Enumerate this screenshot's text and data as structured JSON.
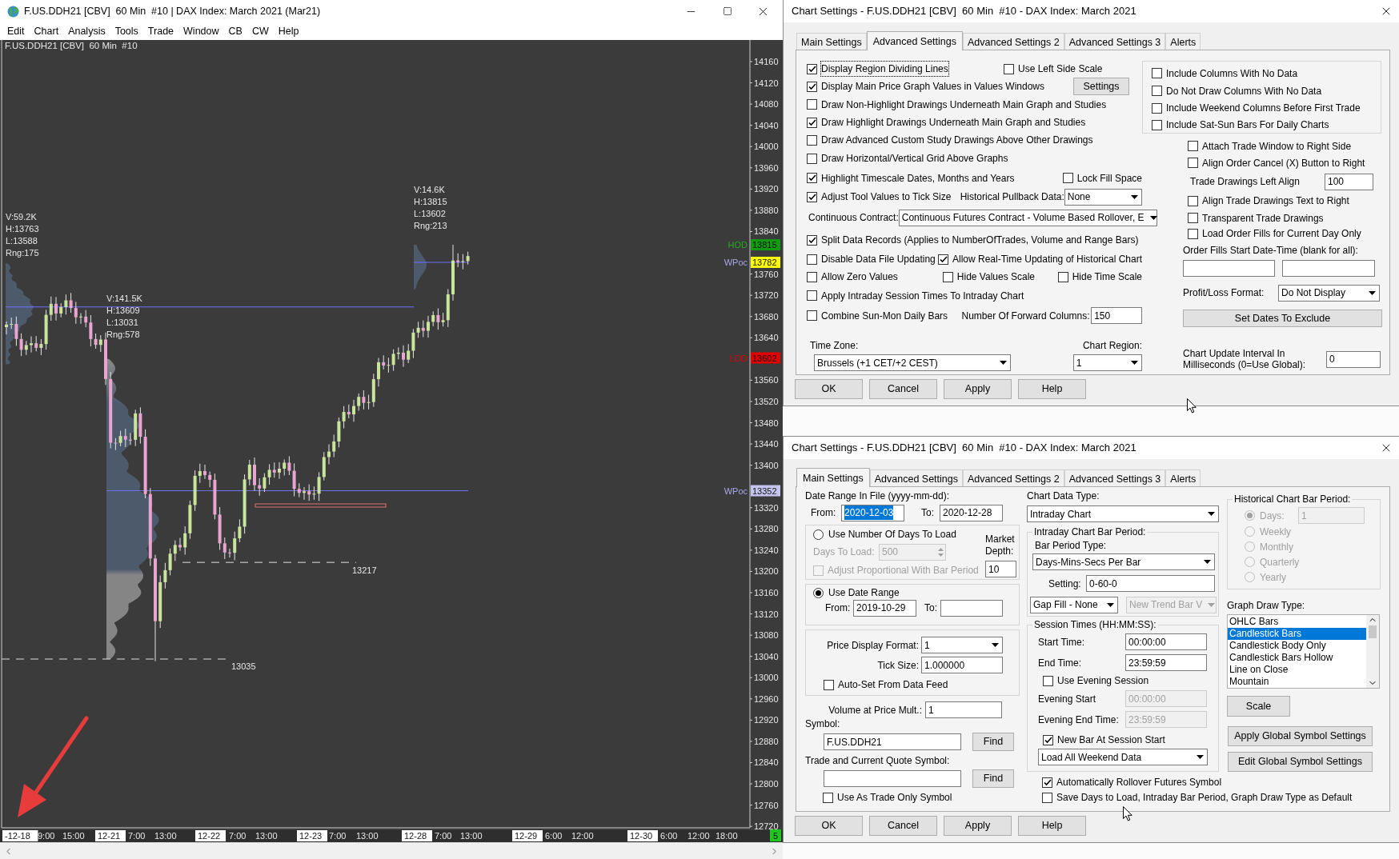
{
  "chart_window": {
    "title": "F.US.DDH21 [CBV]  60 Min  #10 | DAX Index: March 2021 (Mar21)",
    "menu": [
      "Edit",
      "Chart",
      "Analysis",
      "Tools",
      "Trade",
      "Window",
      "CB",
      "CW",
      "Help"
    ],
    "chart_label": "F.US.DDH21 [CBV]  60 Min  #10",
    "session_stats": [
      [
        "V:59.2K",
        "H:13763",
        "L:13588",
        "Rng:175"
      ],
      [
        "V:141.5K",
        "H:13609",
        "L:13031",
        "Rng:578"
      ],
      [
        "V:14.6K",
        "H:13815",
        "L:13602",
        "Rng:213"
      ]
    ],
    "level_labels": [
      "13217",
      "13035"
    ],
    "price_axis": [
      "14160",
      "14120",
      "14080",
      "14040",
      "14000",
      "13960",
      "13920",
      "13880",
      "13840",
      "13760",
      "13720",
      "13680",
      "13640",
      "13560",
      "13520",
      "13480",
      "13440",
      "13400",
      "13320",
      "13280",
      "13240",
      "13200",
      "13160",
      "13120",
      "13080",
      "13040",
      "13000",
      "12960",
      "12920",
      "12880",
      "12840",
      "12800",
      "12760",
      "12720"
    ],
    "price_markers": [
      {
        "kind": "hod",
        "label": "HOD",
        "value": "13815",
        "color": "#139a13"
      },
      {
        "kind": "wpoc",
        "label": "WPoc",
        "value": "13782",
        "color": "#ffff00"
      },
      {
        "kind": "lod",
        "label": "LOD",
        "value": "13602",
        "color": "#e00000"
      },
      {
        "kind": "wpoc",
        "label": "WPoc",
        "value": "13352",
        "color": "#c4c4ee"
      }
    ],
    "time_axis": [
      {
        "label": "-12-18",
        "kind": "date"
      },
      {
        "label": "9:00",
        "kind": "time"
      },
      {
        "label": "15:00",
        "kind": "time"
      },
      {
        "label": "12-21",
        "kind": "date"
      },
      {
        "label": "7:00",
        "kind": "time"
      },
      {
        "label": "13:00",
        "kind": "time"
      },
      {
        "label": "12-22",
        "kind": "date"
      },
      {
        "label": "7:00",
        "kind": "time"
      },
      {
        "label": "13:00",
        "kind": "time"
      },
      {
        "label": "12-23",
        "kind": "date"
      },
      {
        "label": "7:00",
        "kind": "time"
      },
      {
        "label": "13:00",
        "kind": "time"
      },
      {
        "label": "12-28",
        "kind": "date"
      },
      {
        "label": "7:00",
        "kind": "time"
      },
      {
        "label": "13:00",
        "kind": "time"
      },
      {
        "label": "12-29",
        "kind": "date"
      },
      {
        "label": "6:00",
        "kind": "time"
      },
      {
        "label": "12:00",
        "kind": "time"
      },
      {
        "label": "12-30",
        "kind": "date"
      },
      {
        "label": "6:00",
        "kind": "time"
      },
      {
        "label": "12:00",
        "kind": "time"
      },
      {
        "label": "18:00",
        "kind": "time"
      }
    ],
    "bar_counter": "5"
  },
  "advanced_dialog": {
    "title": "Chart Settings - F.US.DDH21 [CBV]  60 Min  #10 - DAX Index: March 2021",
    "tabs": [
      {
        "label": "Main Settings",
        "selected": false
      },
      {
        "label": "Advanced Settings",
        "selected": true
      },
      {
        "label": "Advanced Settings 2",
        "selected": false
      },
      {
        "label": "Advanced Settings 3",
        "selected": false
      },
      {
        "label": "Alerts",
        "selected": false
      }
    ],
    "left_rows": [
      [
        {
          "kind": "checkbox",
          "label": "Display Region Dividing Lines",
          "checked": true,
          "focused": true
        },
        {
          "kind": "checkbox",
          "label": "Use Left Side Scale",
          "checked": false
        }
      ],
      [
        {
          "kind": "checkbox",
          "label": "Display Main Price Graph Values in Values Windows",
          "checked": true
        },
        {
          "kind": "button",
          "label": "Settings"
        }
      ],
      [
        {
          "kind": "checkbox",
          "label": "Draw Non-Highlight Drawings Underneath Main Graph and Studies",
          "checked": false
        }
      ],
      [
        {
          "kind": "checkbox",
          "label": "Draw Highlight Drawings Underneath Main Graph and Studies",
          "checked": true
        }
      ],
      [
        {
          "kind": "checkbox",
          "label": "Draw Advanced Custom Study Drawings Above Other Drawings",
          "checked": false
        }
      ],
      [
        {
          "kind": "checkbox",
          "label": "Draw Horizontal/Vertical Grid Above Graphs",
          "checked": false
        }
      ],
      [
        {
          "kind": "checkbox",
          "label": "Highlight Timescale Dates, Months and Years",
          "checked": true
        },
        {
          "kind": "checkbox",
          "label": "Lock Fill Space",
          "checked": false
        }
      ],
      [
        {
          "kind": "checkbox",
          "label": "Adjust Tool Values to Tick Size",
          "checked": true
        },
        {
          "kind": "label",
          "label": "Historical Pullback Data:"
        },
        {
          "kind": "select",
          "value": "None"
        }
      ],
      [
        {
          "kind": "label",
          "label": "Continuous Contract:"
        },
        {
          "kind": "select",
          "value": "Continuous Futures Contract - Volume Based Rollover, E"
        }
      ],
      [
        {
          "kind": "checkbox",
          "label": "Split Data Records (Applies to NumberOfTrades, Volume and Range Bars)",
          "checked": true
        }
      ],
      [
        {
          "kind": "checkbox",
          "label": "Disable Data File Updating",
          "checked": false
        },
        {
          "kind": "checkbox",
          "label": "Allow Real-Time Updating of Historical Chart",
          "checked": true
        }
      ],
      [
        {
          "kind": "checkbox",
          "label": "Allow Zero Values",
          "checked": false
        },
        {
          "kind": "checkbox",
          "label": "Hide Values Scale",
          "checked": false
        },
        {
          "kind": "checkbox",
          "label": "Hide Time Scale",
          "checked": false
        }
      ],
      [
        {
          "kind": "checkbox",
          "label": "Apply Intraday Session Times To Intraday Chart",
          "checked": false
        }
      ],
      [
        {
          "kind": "checkbox",
          "label": "Combine Sun-Mon Daily Bars",
          "checked": false
        },
        {
          "kind": "label",
          "label": "Number Of Forward Columns:"
        },
        {
          "kind": "field",
          "value": "150"
        }
      ],
      [
        {
          "kind": "label",
          "label": "Time Zone:"
        },
        {
          "kind": "label",
          "label": "Chart Region:"
        }
      ],
      [
        {
          "kind": "select",
          "value": "Brussels (+1 CET/+2 CEST)"
        },
        {
          "kind": "select",
          "value": "1"
        }
      ]
    ],
    "column_options": [
      {
        "label": "Include Columns With No Data",
        "checked": false
      },
      {
        "label": "Do Not Draw Columns With No Data",
        "checked": false
      },
      {
        "label": "Include Weekend Columns Before First Trade",
        "checked": false
      },
      {
        "label": "Include Sat-Sun Bars For Daily Charts",
        "checked": false
      }
    ],
    "trade_window_options": [
      {
        "label": "Attach Trade Window to Right Side",
        "checked": false
      },
      {
        "label": "Align Order Cancel (X) Button to Right",
        "checked": false
      }
    ],
    "left_align": {
      "label": "Trade Drawings Left Align",
      "value": "100"
    },
    "trade_drawing_options": [
      {
        "label": "Align Trade Drawings Text to Right",
        "checked": false
      },
      {
        "label": "Transparent Trade Drawings",
        "checked": false
      },
      {
        "label": "Load Order Fills for Current Day Only",
        "checked": false
      }
    ],
    "order_fills_label": "Order Fills Start Date-Time (blank for all):",
    "profit_loss": {
      "label": "Profit/Loss Format:",
      "value": "Do Not Display"
    },
    "set_dates_button": "Set Dates To Exclude",
    "update_interval": {
      "label": "Chart Update Interval In Milliseconds (0=Use Global):",
      "value": "0"
    },
    "buttons": [
      "OK",
      "Cancel",
      "Apply",
      "Help"
    ]
  },
  "main_dialog": {
    "title": "Chart Settings - F.US.DDH21 [CBV]  60 Min  #10 - DAX Index: March 2021",
    "tabs": [
      {
        "label": "Main Settings",
        "selected": true
      },
      {
        "label": "Advanced Settings",
        "selected": false
      },
      {
        "label": "Advanced Settings 2",
        "selected": false
      },
      {
        "label": "Advanced Settings 3",
        "selected": false
      },
      {
        "label": "Alerts",
        "selected": false
      }
    ],
    "date_range": {
      "label": "Date Range In File (yyyy-mm-dd):",
      "from_label": "From:",
      "from": "2020-12-03",
      "from_selected": true,
      "to_label": "To:",
      "to": "2020-12-28"
    },
    "load_mode": [
      {
        "label": "Use Number Of Days To Load",
        "selected": false
      },
      {
        "label": "Use Date Range",
        "selected": true
      }
    ],
    "days_to_load": {
      "label": "Days To Load:",
      "value": "500",
      "disabled": true
    },
    "adjust_proportional": {
      "label": "Adjust Proportional With Bar Period",
      "checked": false,
      "disabled": true
    },
    "market_depth": {
      "label": "Market Depth:",
      "value": "10"
    },
    "load_range": {
      "from_label": "From:",
      "from": "2019-10-29",
      "to_label": "To:"
    },
    "price_display_format": {
      "label": "Price Display Format:",
      "value": "1"
    },
    "tick_size": {
      "label": "Tick Size:",
      "value": "1.000000"
    },
    "auto_set": {
      "label": "Auto-Set From Data Feed",
      "checked": false
    },
    "volume_mult": {
      "label": "Volume at Price Mult.:",
      "value": "1"
    },
    "symbol": {
      "label": "Symbol:",
      "value": "F.US.DDH21",
      "button": "Find"
    },
    "trade_symbol": {
      "label": "Trade and Current Quote Symbol:",
      "button": "Find"
    },
    "trade_only": {
      "label": "Use As Trade Only Symbol",
      "checked": false
    },
    "chart_data_type": {
      "label": "Chart Data Type:",
      "value": "Intraday Chart"
    },
    "bar_period": {
      "title": "Intraday Chart Bar Period:",
      "type_label": "Bar Period Type:",
      "type": {
        "value": "Days-Mins-Secs Per Bar"
      },
      "setting_label": "Setting:",
      "setting": "0-60-0",
      "gap_fill": {
        "value": "Gap Fill - None"
      },
      "new_trend": {
        "value": "New Trend Bar V",
        "disabled": true
      }
    },
    "session_times": {
      "title": "Session Times (HH:MM:SS):",
      "start_label": "Start Time:",
      "start": "00:00:00",
      "end_label": "End Time:",
      "end": "23:59:59"
    },
    "evening_session": {
      "label": "Use Evening Session",
      "checked": false
    },
    "evening_start": {
      "label": "Evening Start",
      "value": "00:00:00",
      "disabled": true
    },
    "evening_end": {
      "label": "Evening End Time:",
      "value": "23:59:59",
      "disabled": true
    },
    "new_bar_at_session_start": {
      "label": "New Bar At Session Start",
      "checked": true
    },
    "weekend_data": {
      "value": "Load All Weekend Data"
    },
    "auto_rollover": {
      "label": "Automatically Rollover Futures Symbol",
      "checked": true
    },
    "save_defaults": {
      "label": "Save Days to Load, Intraday Bar Period, Graph Draw Type as Default",
      "checked": false
    },
    "historical_period": {
      "title": "Historical Chart Bar Period:",
      "disabled": true,
      "value": "1",
      "options": [
        {
          "label": "Days:",
          "selected": true
        },
        {
          "label": "Weekly",
          "selected": false
        },
        {
          "label": "Monthly",
          "selected": false
        },
        {
          "label": "Quarterly",
          "selected": false
        },
        {
          "label": "Yearly",
          "selected": false
        }
      ]
    },
    "graph_draw_type": {
      "label": "Graph Draw Type:",
      "items": [
        {
          "label": "OHLC Bars",
          "selected": false
        },
        {
          "label": "Candlestick Bars",
          "selected": true
        },
        {
          "label": "Candlestick Body Only",
          "selected": false
        },
        {
          "label": "Candlestick Bars Hollow",
          "selected": false
        },
        {
          "label": "Line on Close",
          "selected": false
        },
        {
          "label": "Mountain",
          "selected": false
        }
      ]
    },
    "scale_button": "Scale",
    "apply_global_button": "Apply Global Symbol Settings",
    "edit_global_button": "Edit Global Symbol Settings",
    "buttons": [
      "OK",
      "Cancel",
      "Apply",
      "Help"
    ]
  }
}
